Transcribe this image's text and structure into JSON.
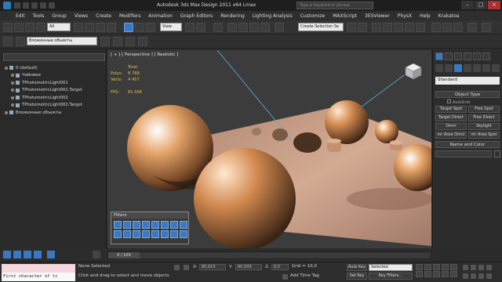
{
  "window": {
    "title": "Autodesk 3ds Max Design 2011 x64     Lmax",
    "search_placeholder": "Type a keyword or phrase"
  },
  "menu": [
    "Edit",
    "Tools",
    "Group",
    "Views",
    "Create",
    "Modifiers",
    "Animation",
    "Graph Editors",
    "Rendering",
    "Lighting Analysis",
    "Customize",
    "MAXScript",
    "3ESViewer",
    "PhysX",
    "Help",
    "Krakatoa"
  ],
  "toolbar": {
    "filter_value": "All",
    "view_value": "View",
    "selection_set": "Create Selection Se",
    "layer_value": "Вложенные объекты"
  },
  "scene_explorer": {
    "items": [
      "0 (default)",
      "Чайники",
      "TPhotometricLight001",
      "TPhotometricLight001.Target",
      "TPhotometricLight002",
      "TPhotometricLight002.Target",
      "Вложенные объекты"
    ]
  },
  "viewport": {
    "label": "[ + ] [ Perspective ] [ Realistic ]",
    "stats": {
      "total_label": "Total",
      "polys_label": "Polys:",
      "polys_value": "8 768",
      "verts_label": "Verts:",
      "verts_value": "4 457",
      "fps_label": "FPS:",
      "fps_value": "81.566"
    }
  },
  "filters_panel": {
    "title": "Filters"
  },
  "command_panel": {
    "category": "Standard",
    "object_type_title": "Object Type",
    "autogrid_label": "AutoGrid",
    "buttons": [
      "Target Spot",
      "Free Spot",
      "Target Direct",
      "Free Direct",
      "Omni",
      "Skylight",
      "mr Area Omni",
      "mr Area Spot"
    ],
    "name_color_title": "Name and Color"
  },
  "timeline": {
    "frame_label": "0 / 100"
  },
  "status": {
    "maxscript_text": "First character of tc",
    "selection_text": "None Selected",
    "prompt_text": "Click and drag to select and move objects",
    "x_label": "X:",
    "x_value": "80,619",
    "y_label": "Y:",
    "y_value": "40,509",
    "z_label": "Z:",
    "z_value": "0,0",
    "grid_text": "Grid = 10,0",
    "add_time_tag": "Add Time Tag",
    "auto_key": "Auto Key",
    "set_key": "Set Key",
    "key_mode_value": "Selected",
    "key_filters": "Key Filters..."
  },
  "colors": {
    "accent": "#3a78c4",
    "stats_text": "#e0c040",
    "floor": "#c9a088",
    "sphere": "#d9955a"
  }
}
